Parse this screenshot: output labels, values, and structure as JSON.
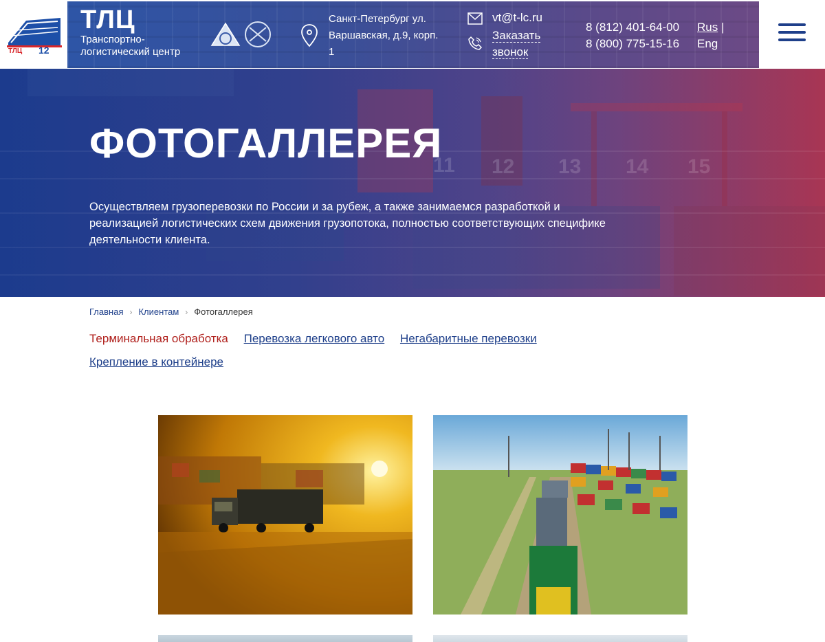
{
  "header": {
    "logo_text": "ТЛЦ 12 ЛЕТ",
    "brand_title": "ТЛЦ",
    "brand_subtitle": "Транспортно-логистический центр",
    "address": "Санкт-Петербург ул. Варшавская, д.9, корп. 1",
    "email": "vt@t-lc.ru",
    "callback": "Заказать звонок",
    "phone1": "8 (812) 401-64-00",
    "phone2": "8 (800) 775-15-16",
    "lang_rus": "Rus",
    "lang_sep": "|",
    "lang_eng": "Eng"
  },
  "hero": {
    "title": "ФОТОГАЛЛЕРЕЯ",
    "text": "Осуществляем грузоперевозки по России и за рубеж, а также занимаемся разработкой и реализацией логистических схем движения грузопотока, полностью соответствующих специфике деятельности клиента."
  },
  "breadcrumb": {
    "home": "Главная",
    "clients": "Клиентам",
    "current": "Фотогаллерея"
  },
  "categories": [
    "Терминальная обработка",
    "Перевозка легкового авто",
    "Негабаритные перевозки",
    "Крепление в контейнере"
  ],
  "colors": {
    "brand_blue": "#1e3f8a",
    "active_red": "#b0201c",
    "hero_gradient_left": "#1e3c8c",
    "hero_gradient_right": "#a23a58"
  }
}
